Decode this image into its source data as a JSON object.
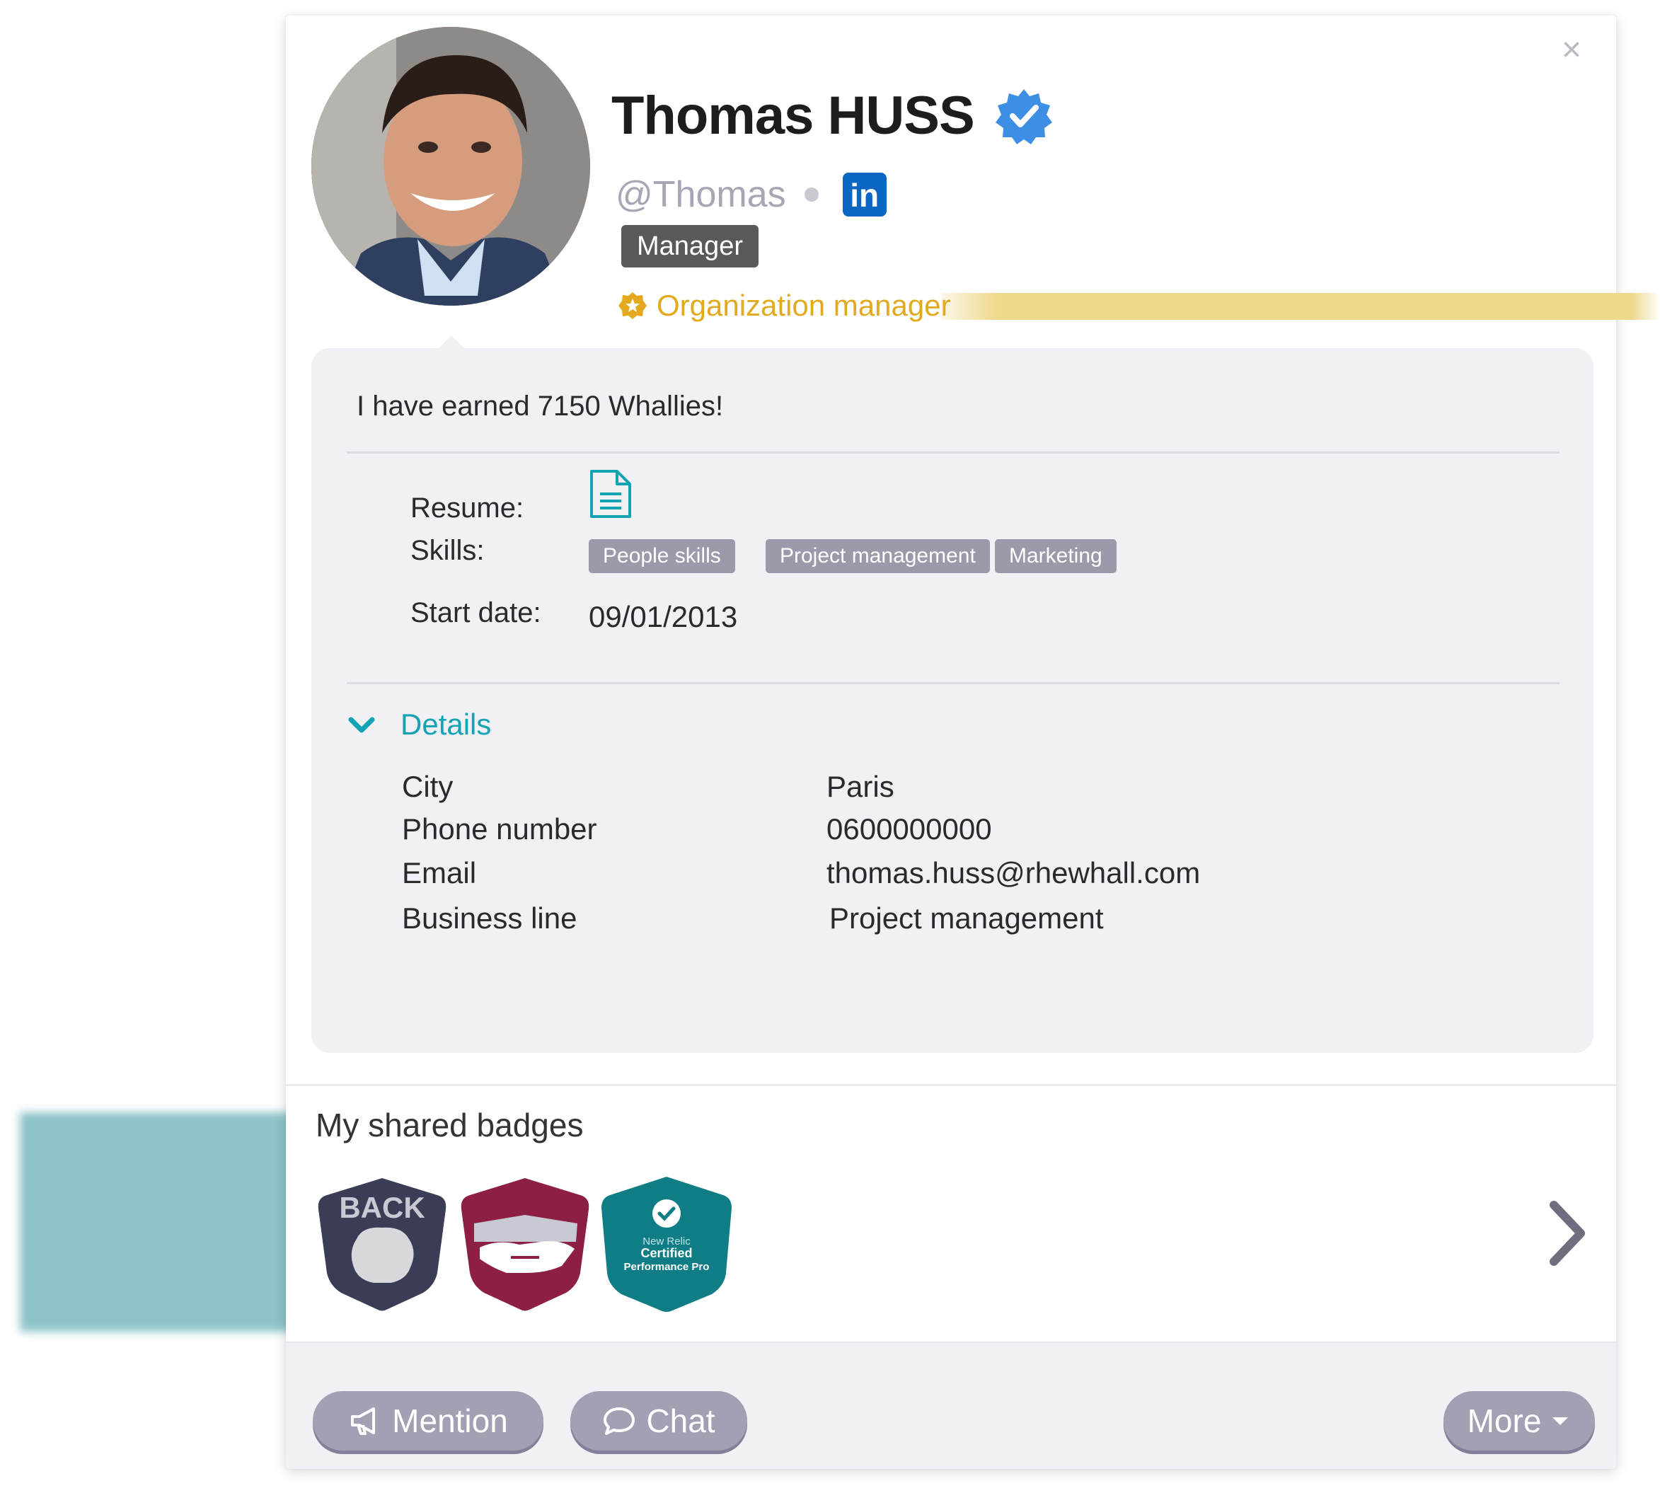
{
  "profile": {
    "name": "Thomas HUSS",
    "handle": "@Thomas",
    "linkedin_label": "in",
    "role": "Manager",
    "org_role": "Organization manager",
    "verified": true
  },
  "summary": {
    "whallies_text": "I have earned 7150 Whallies!"
  },
  "properties": {
    "resume_label": "Resume:",
    "skills_label": "Skills:",
    "skills": [
      "People skills",
      "Project management",
      "Marketing"
    ],
    "start_date_label": "Start date:",
    "start_date": "09/01/2013"
  },
  "details": {
    "toggle_label": "Details",
    "rows": [
      {
        "label": "City",
        "value": "Paris"
      },
      {
        "label": "Phone number",
        "value": "0600000000"
      },
      {
        "label": "Email",
        "value": "thomas.huss@rhewhall.com"
      },
      {
        "label": "Business line",
        "value": "Project management"
      }
    ]
  },
  "badges": {
    "title": "My shared badges",
    "items": [
      {
        "icon": "back-badge-icon",
        "text": "BACK",
        "color": "#3a3d55"
      },
      {
        "icon": "handshake-badge-icon",
        "text": "",
        "color": "#8c1f43"
      },
      {
        "icon": "new-relic-badge-icon",
        "text": "New Relic Certified Performance Pro",
        "color": "#0f7d86"
      }
    ]
  },
  "actions": {
    "mention": "Mention",
    "chat": "Chat",
    "more": "More"
  },
  "colors": {
    "accent": "#14a3b2",
    "org": "#e3a91f",
    "verified": "#3d8fe6",
    "linkedin": "#0a66c2",
    "button": "#a2a0b2"
  }
}
